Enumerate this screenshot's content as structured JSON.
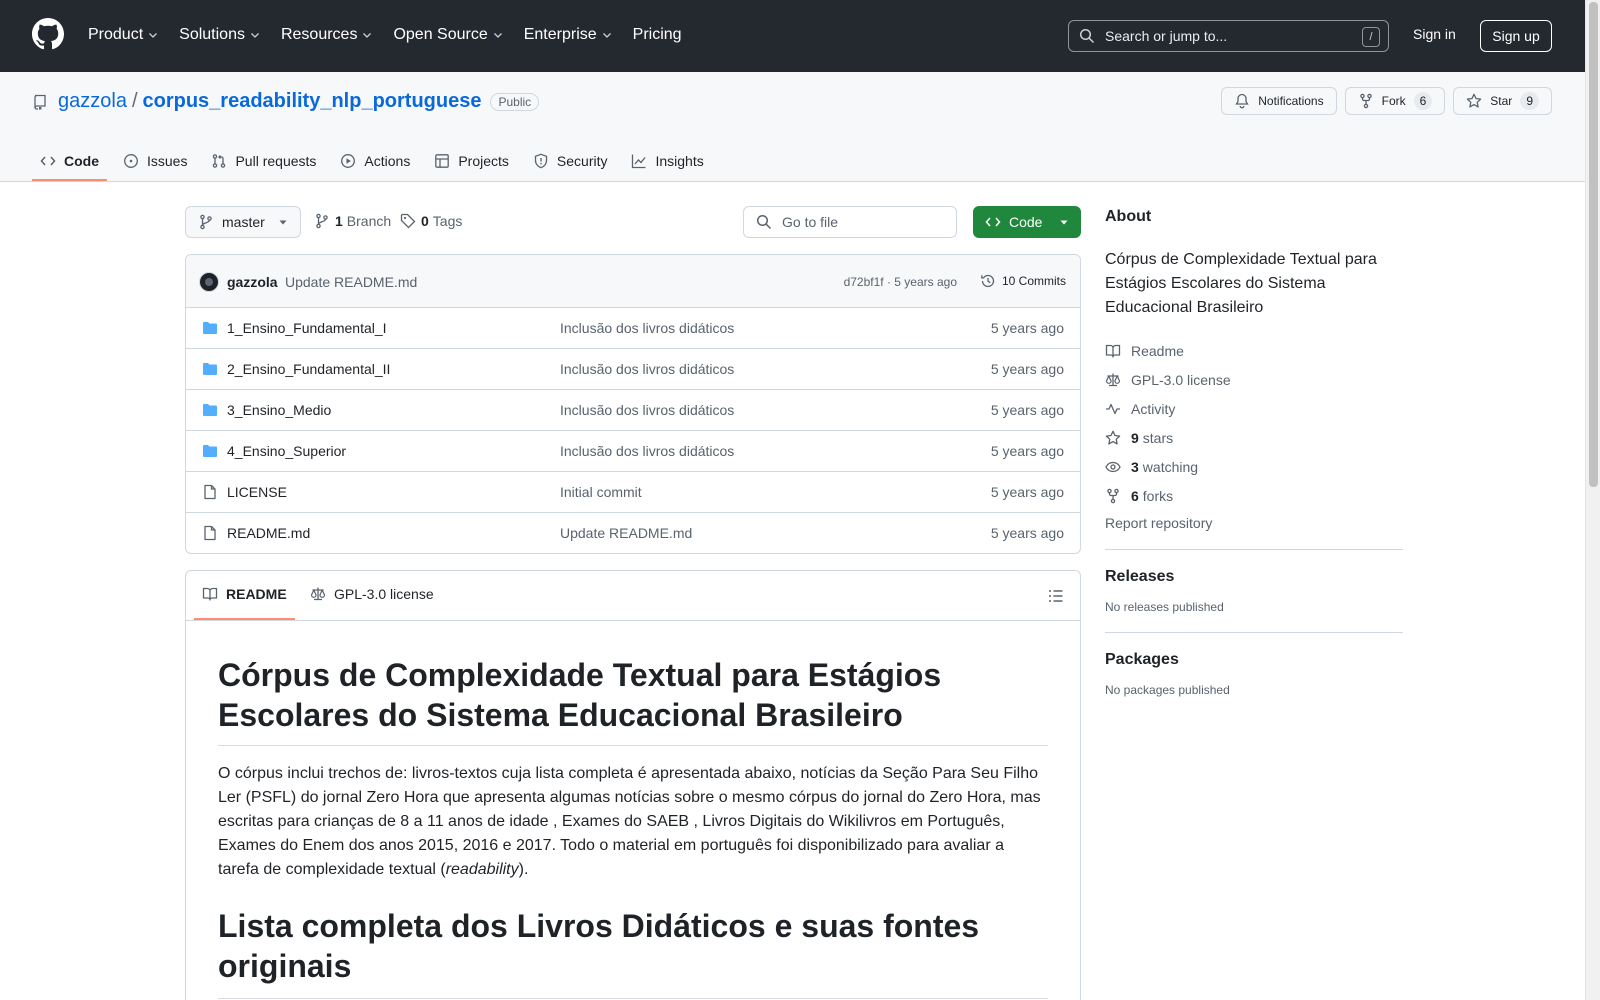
{
  "header": {
    "nav": [
      {
        "label": "Product",
        "dropdown": true
      },
      {
        "label": "Solutions",
        "dropdown": true
      },
      {
        "label": "Resources",
        "dropdown": true
      },
      {
        "label": "Open Source",
        "dropdown": true
      },
      {
        "label": "Enterprise",
        "dropdown": true
      },
      {
        "label": "Pricing",
        "dropdown": false
      }
    ],
    "search_placeholder": "Search or jump to...",
    "search_key": "/",
    "signin": "Sign in",
    "signup": "Sign up"
  },
  "repo": {
    "owner": "gazzola",
    "separator": "/",
    "name": "corpus_readability_nlp_portuguese",
    "visibility": "Public",
    "notifications": "Notifications",
    "fork_label": "Fork",
    "fork_count": "6",
    "star_label": "Star",
    "star_count": "9"
  },
  "tabs": [
    {
      "label": "Code",
      "icon": "code-icon",
      "active": true
    },
    {
      "label": "Issues",
      "icon": "issue-icon"
    },
    {
      "label": "Pull requests",
      "icon": "pull-request-icon"
    },
    {
      "label": "Actions",
      "icon": "play-icon"
    },
    {
      "label": "Projects",
      "icon": "table-icon"
    },
    {
      "label": "Security",
      "icon": "shield-icon"
    },
    {
      "label": "Insights",
      "icon": "graph-icon"
    }
  ],
  "toolbar": {
    "branch": "master",
    "branch_count": "1",
    "branch_label": "Branch",
    "tag_count": "0",
    "tag_label": "Tags",
    "goto_placeholder": "Go to file",
    "code_button": "Code"
  },
  "commit": {
    "author": "gazzola",
    "message": "Update README.md",
    "hash_age": "d72bf1f · 5 years ago",
    "commits": "10 Commits"
  },
  "files": [
    {
      "name": "1_Ensino_Fundamental_I",
      "type": "folder",
      "message": "Inclusão dos livros didáticos",
      "age": "5 years ago"
    },
    {
      "name": "2_Ensino_Fundamental_II",
      "type": "folder",
      "message": "Inclusão dos livros didáticos",
      "age": "5 years ago"
    },
    {
      "name": "3_Ensino_Medio",
      "type": "folder",
      "message": "Inclusão dos livros didáticos",
      "age": "5 years ago"
    },
    {
      "name": "4_Ensino_Superior",
      "type": "folder",
      "message": "Inclusão dos livros didáticos",
      "age": "5 years ago"
    },
    {
      "name": "LICENSE",
      "type": "file",
      "message": "Initial commit",
      "age": "5 years ago"
    },
    {
      "name": "README.md",
      "type": "file",
      "message": "Update README.md",
      "age": "5 years ago"
    }
  ],
  "readme": {
    "tab_readme": "README",
    "tab_license": "GPL-3.0 license",
    "h1": "Córpus de Complexidade Textual para Estágios Escolares do Sistema Educacional Brasileiro",
    "p_before": "O córpus inclui trechos de: livros-textos cuja lista completa é apresentada abaixo, notícias da Seção Para Seu Filho Ler (PSFL) do jornal Zero Hora que apresenta algumas notícias sobre o mesmo córpus do jornal do Zero Hora, mas escritas para crianças de 8 a 11 anos de idade , Exames do SAEB , Livros Digitais do Wikilivros em Português, Exames do Enem dos anos 2015, 2016 e 2017. Todo o material em português foi disponibilizado para avaliar a tarefa de complexidade textual (",
    "p_em": "readability",
    "p_after": ").",
    "h2": "Lista completa dos Livros Didáticos e suas fontes originais"
  },
  "sidebar": {
    "about_title": "About",
    "about_text": "Córpus de Complexidade Textual para Estágios Escolares do Sistema Educacional Brasileiro",
    "readme": "Readme",
    "license": "GPL-3.0 license",
    "activity": "Activity",
    "stars_count": "9",
    "stars_label": "stars",
    "watching_count": "3",
    "watching_label": "watching",
    "forks_count": "6",
    "forks_label": "forks",
    "report": "Report repository",
    "releases_title": "Releases",
    "releases_text": "No releases published",
    "packages_title": "Packages",
    "packages_text": "No packages published"
  }
}
